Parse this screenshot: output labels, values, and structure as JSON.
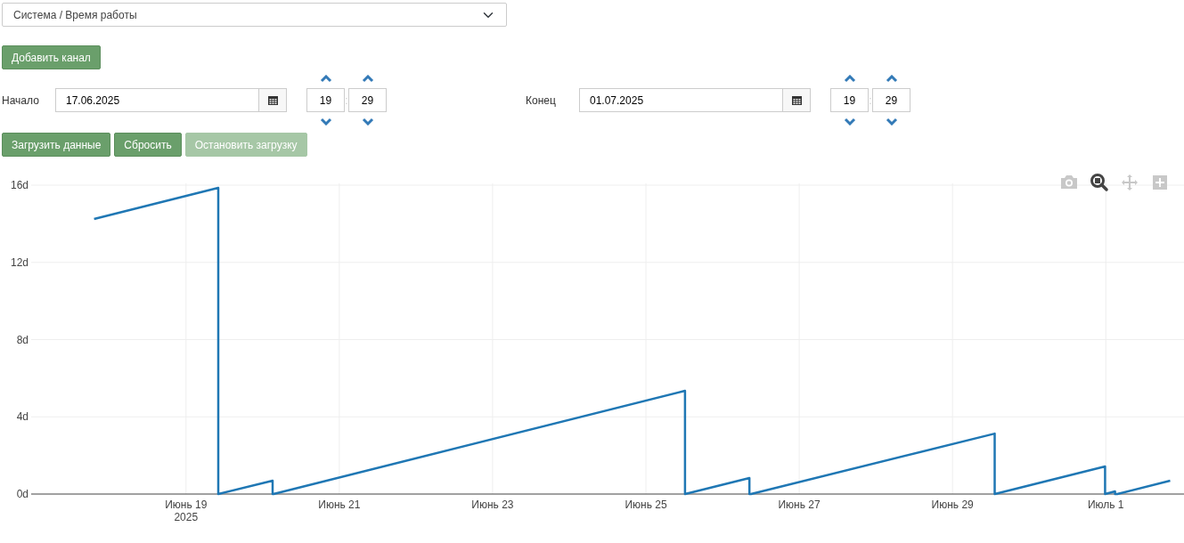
{
  "channel_select": {
    "value": "Система / Время работы"
  },
  "add_channel_button": {
    "label": "Добавить канал"
  },
  "range": [
    {
      "label": "Начало",
      "date": "17.06.2025",
      "hours": "19",
      "separator": ":",
      "minutes": "29"
    },
    {
      "label": "Конец",
      "date": "01.07.2025",
      "hours": "19",
      "separator": ":",
      "minutes": "29"
    }
  ],
  "actions": [
    {
      "label": "Загрузить данные",
      "disabled": false
    },
    {
      "label": "Сбросить",
      "disabled": false
    },
    {
      "label": "Остановить загрузку",
      "disabled": true
    }
  ],
  "modebar": [
    {
      "kind": "camera",
      "selected": false
    },
    {
      "kind": "zoom",
      "selected": true
    },
    {
      "kind": "pan",
      "selected": false
    },
    {
      "kind": "autoscale",
      "selected": false
    }
  ],
  "chart": {
    "chart_data": {
      "type": "line",
      "x": [
        "2025-06-17T19:12",
        "2025-06-19T10:05",
        "2025-06-19T10:05",
        "2025-06-20T03:07",
        "2025-06-20T03:07",
        "2025-06-20T03:22",
        "2025-06-25T12:14",
        "2025-06-25T12:14",
        "2025-06-26T08:24",
        "2025-06-26T08:24",
        "2025-06-26T08:53",
        "2025-06-29T13:12",
        "2025-06-29T13:12",
        "2025-06-30T23:46",
        "2025-06-30T23:46",
        "2025-07-01T02:53",
        "2025-07-01T02:53",
        "2025-07-01T03:36",
        "2025-07-01T20:10"
      ],
      "series": [
        {
          "color": "#1f77b4",
          "values": [
            14.25,
            15.86,
            0,
            0.69,
            0,
            0,
            5.35,
            0,
            0.83,
            0,
            0,
            3.13,
            0,
            1.43,
            0,
            0.14,
            0,
            0,
            0.69
          ]
        }
      ],
      "xlim": [
        "2025-06-16T23:31",
        "2025-07-02T00:29"
      ],
      "ylim": [
        0,
        16
      ],
      "xticks": [
        {
          "value": "2025-06-19",
          "label": "Июнь 19"
        },
        {
          "value": "2025-06-21",
          "label": "Июнь 21"
        },
        {
          "value": "2025-06-23",
          "label": "Июнь 23"
        },
        {
          "value": "2025-06-25",
          "label": "Июнь 25"
        },
        {
          "value": "2025-06-27",
          "label": "Июнь 27"
        },
        {
          "value": "2025-06-29",
          "label": "Июнь 29"
        },
        {
          "value": "2025-07-01",
          "label": "Июль 1"
        }
      ],
      "yticks": [
        {
          "value": 0,
          "label": "0d"
        },
        {
          "value": 4,
          "label": "4d"
        },
        {
          "value": 8,
          "label": "8d"
        },
        {
          "value": 12,
          "label": "12d"
        },
        {
          "value": 16,
          "label": "16d"
        }
      ],
      "grid": true,
      "annotations": [
        "2025"
      ]
    }
  }
}
